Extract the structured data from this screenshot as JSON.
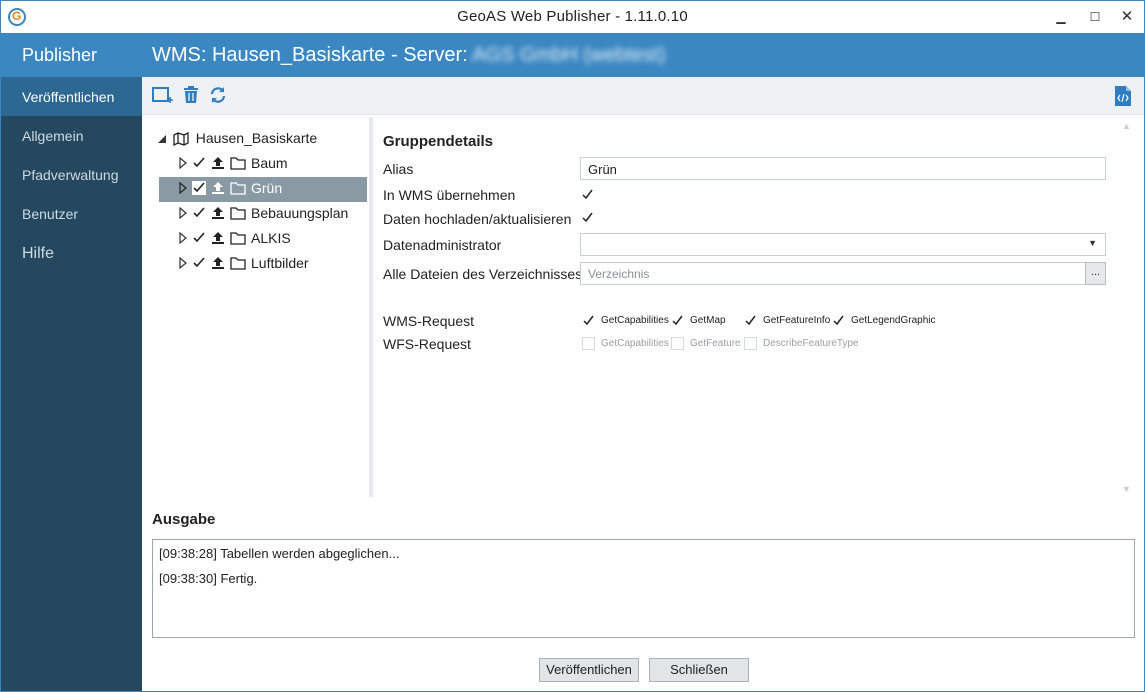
{
  "window": {
    "title": "GeoAS Web Publisher - 1.11.0.10",
    "controls": {
      "minimize": "▁",
      "maximize": "☐",
      "close": "✕"
    }
  },
  "sidebar": {
    "title": "Publisher",
    "items": [
      {
        "label": "Veröffentlichen",
        "active": true
      },
      {
        "label": "Allgemein"
      },
      {
        "label": "Pfadverwaltung"
      },
      {
        "label": "Benutzer"
      },
      {
        "label": "Hilfe"
      }
    ]
  },
  "header": {
    "prefix": "WMS: Hausen_Basiskarte - Server: ",
    "server": "AGS GmbH (webtest)"
  },
  "toolbar": {
    "icons": [
      "add-layer-icon",
      "delete-icon",
      "refresh-icon",
      "code-file-icon"
    ]
  },
  "tree": {
    "root": "Hausen_Basiskarte",
    "items": [
      {
        "label": "Baum",
        "checked": true,
        "selected": false
      },
      {
        "label": "Grün",
        "checked": true,
        "selected": true
      },
      {
        "label": "Bebauungsplan",
        "checked": true,
        "selected": false
      },
      {
        "label": "ALKIS",
        "checked": true,
        "selected": false
      },
      {
        "label": "Luftbilder",
        "checked": true,
        "selected": false
      }
    ]
  },
  "details": {
    "title": "Gruppendetails",
    "alias_label": "Alias",
    "alias_value": "Grün",
    "wms_label": "In WMS übernehmen",
    "wms_checked": true,
    "upload_label": "Daten hochladen/aktualisieren",
    "upload_checked": true,
    "admin_label": "Datenadministrator",
    "admin_value": "",
    "files_label": "Alle Dateien des Verzeichnisses",
    "files_placeholder": "Verzeichnis",
    "browse_label": "...",
    "wms_request_label": "WMS-Request",
    "wfs_request_label": "WFS-Request",
    "wms_requests": [
      {
        "label": "GetCapabilities",
        "checked": true
      },
      {
        "label": "GetMap",
        "checked": true
      },
      {
        "label": "GetFeatureInfo",
        "checked": true
      },
      {
        "label": "GetLegendGraphic",
        "checked": true
      }
    ],
    "wfs_requests": [
      {
        "label": "GetCapabilities",
        "checked": false
      },
      {
        "label": "GetFeature",
        "checked": false
      },
      {
        "label": "DescribeFeatureType",
        "checked": false
      }
    ]
  },
  "output": {
    "title": "Ausgabe",
    "lines": [
      "[09:38:28] Tabellen werden abgeglichen...",
      "[09:38:30] Fertig."
    ]
  },
  "buttons": {
    "publish": "Veröffentlichen",
    "close": "Schließen"
  },
  "colors": {
    "accent": "#3a87c2",
    "sidebar": "#24485f",
    "sidebar_active": "#2d6892",
    "tree_selected": "#8a9aa5"
  }
}
